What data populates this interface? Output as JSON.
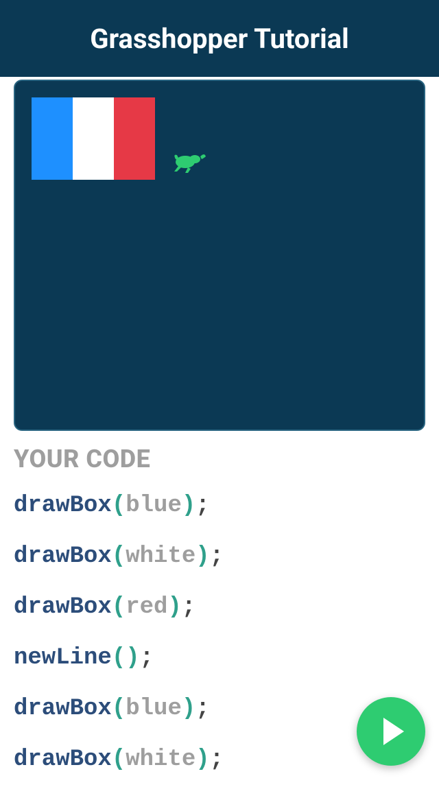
{
  "header": {
    "title": "Grasshopper Tutorial"
  },
  "colors": {
    "header_bg": "#0b3954",
    "canvas_bg": "#0b3954",
    "canvas_border": "#2a6581",
    "play_bg": "#2ecc71",
    "box_blue": "#1e90ff",
    "box_white": "#ffffff",
    "box_red": "#e63946"
  },
  "canvas": {
    "boxes": [
      "blue",
      "white",
      "red"
    ],
    "mascot": "grasshopper-icon"
  },
  "code": {
    "heading": "YOUR CODE",
    "lines": [
      {
        "fn": "drawBox",
        "arg": "blue"
      },
      {
        "fn": "drawBox",
        "arg": "white"
      },
      {
        "fn": "drawBox",
        "arg": "red"
      },
      {
        "fn": "newLine",
        "arg": ""
      },
      {
        "fn": "drawBox",
        "arg": "blue"
      },
      {
        "fn": "drawBox",
        "arg": "white"
      }
    ],
    "paren_open": "(",
    "paren_close": ")",
    "semicolon": ";"
  },
  "play": {
    "label": "Play"
  }
}
